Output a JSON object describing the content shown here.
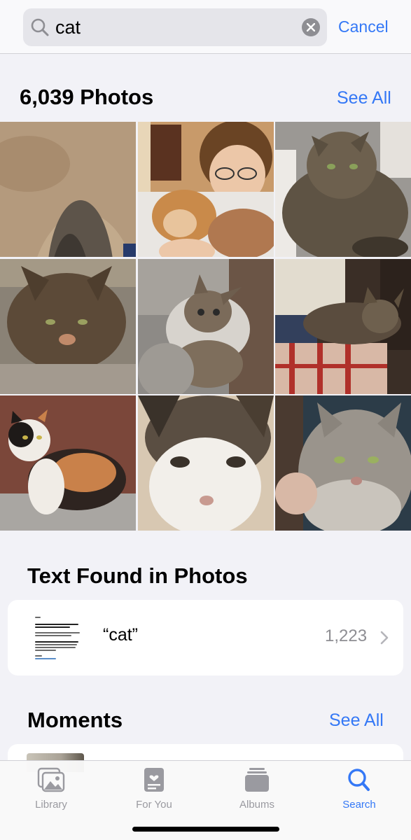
{
  "search": {
    "query": "cat",
    "cancel_label": "Cancel"
  },
  "photos_section": {
    "title": "6,039 Photos",
    "see_all_label": "See All"
  },
  "text_found": {
    "title": "Text Found in Photos",
    "query_label": "“cat”",
    "count": "1,223"
  },
  "moments": {
    "title": "Moments",
    "see_all_label": "See All"
  },
  "tab_bar": {
    "tabs": [
      {
        "label": "Library",
        "icon": "photo-library-icon",
        "active": false
      },
      {
        "label": "For You",
        "icon": "for-you-icon",
        "active": false
      },
      {
        "label": "Albums",
        "icon": "albums-icon",
        "active": false
      },
      {
        "label": "Search",
        "icon": "search-icon",
        "active": true
      }
    ]
  },
  "colors": {
    "accent": "#3478f6",
    "background": "#f2f2f7",
    "inactive_tab": "#9a9aa0"
  }
}
